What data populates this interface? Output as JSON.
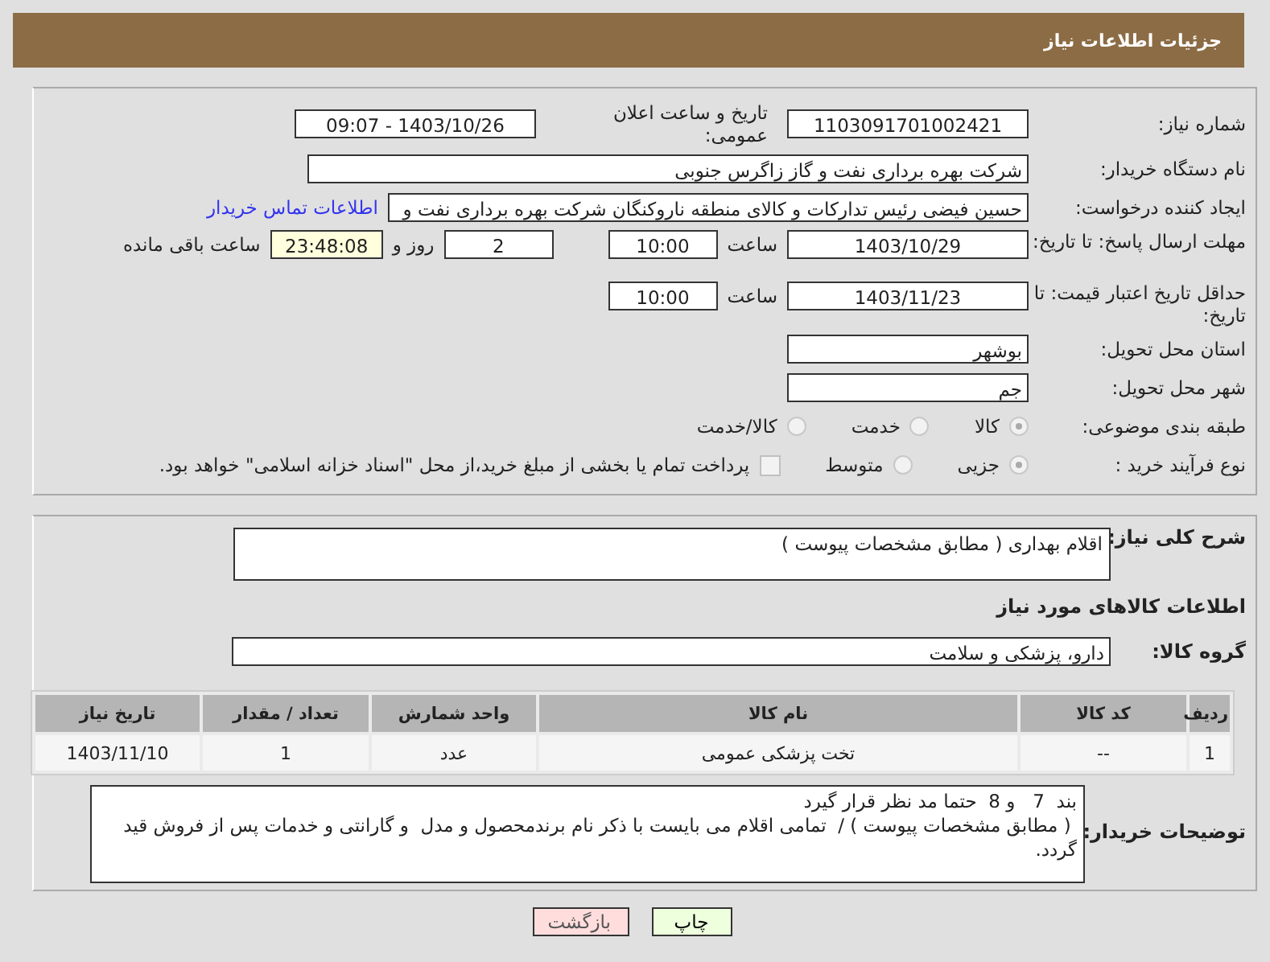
{
  "header": {
    "title": "جزئیات اطلاعات نیاز"
  },
  "need_number": {
    "label": "شماره نیاز:",
    "value": "1103091701002421"
  },
  "announce": {
    "label": "تاریخ و ساعت اعلان عمومی:",
    "value": "1403/10/26 - 09:07"
  },
  "buyer": {
    "label": "نام دستگاه خریدار:",
    "value": "شرکت بهره برداری نفت و گاز زاگرس جنوبی"
  },
  "creator": {
    "label": "ایجاد کننده درخواست:",
    "value": "حسین فیضی رئیس تدارکات و کالای منطقه ناروکنگان شرکت بهره برداری نفت و",
    "link": "اطلاعات تماس خریدار"
  },
  "reply_deadline": {
    "label": "مهلت ارسال پاسخ: تا تاریخ:",
    "date": "1403/10/29",
    "time_label": "ساعت",
    "time": "10:00",
    "days": "2",
    "days_label": "روز و",
    "remaining": "23:48:08",
    "remaining_label": "ساعت باقی مانده"
  },
  "price_validity": {
    "label": "حداقل تاریخ اعتبار قیمت: تا تاریخ:",
    "date": "1403/11/23",
    "time_label": "ساعت",
    "time": "10:00"
  },
  "province": {
    "label": "استان محل تحویل:",
    "value": "بوشهر"
  },
  "city": {
    "label": "شهر محل تحویل:",
    "value": "جم"
  },
  "category": {
    "label": "طبقه بندی موضوعی:",
    "options": [
      {
        "label": "کالا",
        "selected": true
      },
      {
        "label": "خدمت",
        "selected": false
      },
      {
        "label": "کالا/خدمت",
        "selected": false
      }
    ]
  },
  "process": {
    "label": "نوع فرآیند خرید :",
    "options": [
      {
        "label": "جزیی",
        "selected": true
      },
      {
        "label": "متوسط",
        "selected": false
      }
    ],
    "payment": {
      "checked": false,
      "text": "پرداخت تمام یا بخشی از مبلغ خرید،از محل \"اسناد خزانه اسلامی\" خواهد بود."
    }
  },
  "description": {
    "label": "شرح کلی نیاز:",
    "value": "اقلام بهداری  (  مطابق مشخصات پیوست  )"
  },
  "goods_heading": "اطلاعات کالاهای مورد نیاز",
  "goods_group": {
    "label": "گروه کالا:",
    "value": "دارو، پزشکی و سلامت"
  },
  "table": {
    "columns": [
      "ردیف",
      "کد کالا",
      "نام کالا",
      "واحد شمارش",
      "تعداد / مقدار",
      "تاریخ نیاز"
    ],
    "rows": [
      [
        "1",
        "--",
        "تخت پزشکی عمومی",
        "عدد",
        "1",
        "1403/11/10"
      ]
    ]
  },
  "buyer_notes": {
    "label": "توضیحات خریدار:",
    "value": "بند  7   و 8  حتما مد نظر قرار گیرد\n ( مطابق مشخصات پیوست ) /  تمامی اقلام می بایست با ذکر نام برندمحصول و مدل  و گارانتی و خدمات پس از فروش قید گردد."
  },
  "buttons": [
    {
      "label": "چاپ",
      "kind": "print"
    },
    {
      "label": "بازگشت",
      "kind": "back"
    }
  ]
}
